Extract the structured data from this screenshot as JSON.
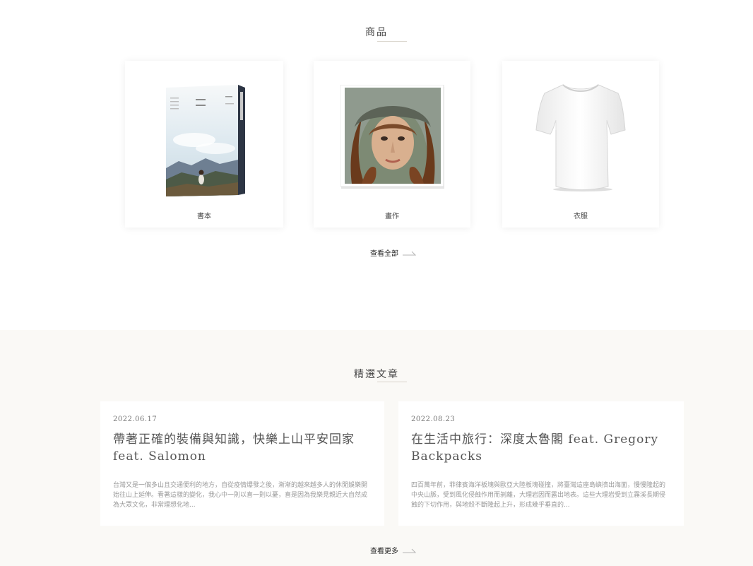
{
  "products": {
    "title": "商品",
    "items": [
      {
        "label": "書本",
        "image": "book-cover-image"
      },
      {
        "label": "畫作",
        "image": "portrait-painting-image"
      },
      {
        "label": "衣服",
        "image": "white-tshirt-image"
      }
    ],
    "view_all": "查看全部"
  },
  "articles": {
    "title": "精選文章",
    "items": [
      {
        "date": "2022.06.17",
        "title": "帶著正確的裝備與知識，快樂上山平安回家 feat. Salomon",
        "excerpt": "台灣又是一個多山且交通便利的地方，自從疫情爆發之後，漸漸的越來越多人的休閒娛樂開始往山上延伸。看著這樣的變化，我心中一則以喜一則以憂，喜是因為我樂見親近大自然成為大眾文化，非常理想化地..."
      },
      {
        "date": "2022.08.23",
        "title": "在生活中旅行：深度太魯閣 feat. Gregory Backpacks",
        "excerpt": "四百萬年前，菲律賓海洋板塊與歐亞大陸板塊碰撞，將臺灣這座島嶼擠出海面，慢慢隆起的中央山脈，受到風化侵蝕作用而剝離，大理岩因而露出地表。這些大理岩受到立霧溪長期侵蝕的下切作用，與地殼不斷隆起上升，形成幾乎垂直的..."
      }
    ],
    "view_more": "查看更多"
  },
  "colors": {
    "background": "#ffffff",
    "articles_background": "#faf9f6",
    "text": "#333333",
    "muted": "#9a9a9a"
  }
}
